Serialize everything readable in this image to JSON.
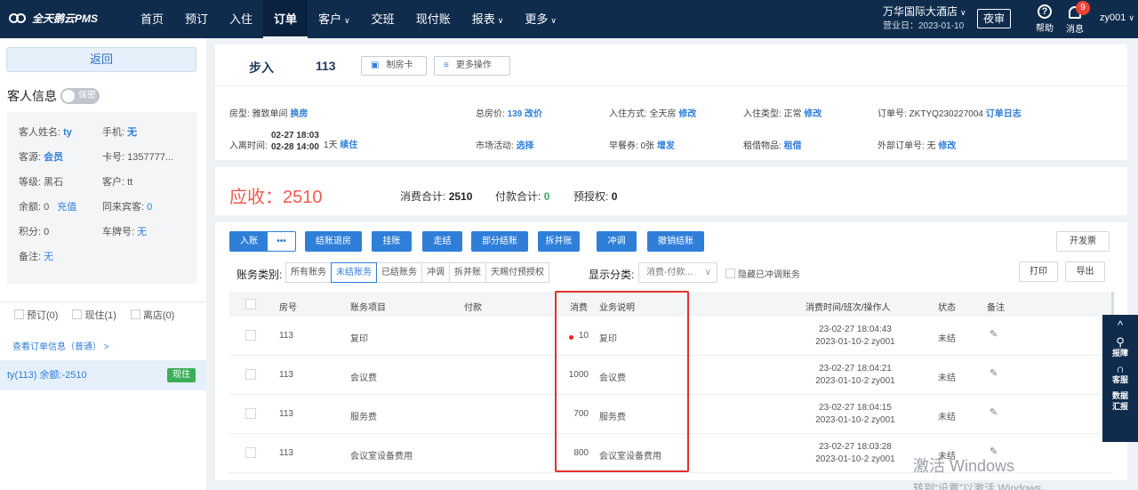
{
  "app": {
    "name": "全天鹅云PMS"
  },
  "nav": [
    "首页",
    "预订",
    "入住",
    "订单",
    "客户",
    "交班",
    "现付账",
    "报表",
    "更多"
  ],
  "hotel": {
    "name": "万华国际大酒店",
    "business_date": "营业日：2023-01-10",
    "night_audit": "夜审"
  },
  "header": {
    "help": "帮助",
    "messages": "消息",
    "message_count": "9",
    "user": "zy001"
  },
  "left": {
    "back": "返回",
    "guest_info_title": "客人信息",
    "secret_label": "保密",
    "fields": {
      "name_label": "客人姓名:",
      "name_value": "ty",
      "phone_label": "手机:",
      "phone_value": "无",
      "source_label": "客源:",
      "source_value": "会员",
      "card_label": "卡号: 1357777...",
      "level_label": "等级: 黑石",
      "customer_label": "客户: tt",
      "balance_label": "余额: 0",
      "recharge": "充值",
      "companions_label": "同来宾客:",
      "companions_value": "0",
      "points_label": "积分: 0",
      "plate_label": "车牌号:",
      "plate_value": "无",
      "remark_label": "备注:",
      "remark_value": "无"
    },
    "filters": {
      "reserved": "预订(0)",
      "inhouse": "现住(1)",
      "checkedout": "离店(0)"
    },
    "view_order": "查看订单信息（普通） >",
    "room_item": "ty(113)  余额:-2510",
    "room_status": "现住"
  },
  "order": {
    "type": "步入",
    "room": "113",
    "make_card": "制房卡",
    "more_ops": "更多操作",
    "room_type_label": "房型: 雅致单间",
    "change_room": "换房",
    "total_price_label": "总房价:",
    "total_price_value": "139",
    "change_price": "改价",
    "checkin_mode_label": "入住方式: 全天房",
    "edit1": "修改",
    "checkin_type_label": "入住类型: 正常",
    "edit2": "修改",
    "order_no_label": "订单号: ZKTYQ230227004",
    "order_log": "订单日志",
    "time_label": "入离时间:",
    "time_in": "02-27 18:03",
    "time_out": "02-28 14:00",
    "nights": "1天",
    "extend": "续住",
    "promo_label": "市场活动:",
    "promo_select": "选择",
    "breakfast_label": "早餐券: 0张",
    "breakfast_add": "增发",
    "rental_label": "租借物品:",
    "rental_link": "租借",
    "ext_order_label": "外部订单号: 无",
    "edit3": "修改"
  },
  "summary": {
    "receivable": "应收：2510",
    "consume_label": "消费合计:",
    "consume_value": "2510",
    "pay_label": "付款合计:",
    "pay_value": "0",
    "preauth_label": "预授权:",
    "preauth_value": "0"
  },
  "actions": {
    "post": "入账",
    "dots": "•••",
    "checkout": "结账退房",
    "hang": "挂账",
    "walk": "走结",
    "partial": "部分结账",
    "split": "拆并账",
    "offset": "冲调",
    "cancel": "撤销结账",
    "invoice": "开发票",
    "print": "打印",
    "export": "导出"
  },
  "filters": {
    "acct_label": "账务类别:",
    "acct_tabs": [
      "所有账务",
      "未结账务",
      "已结账务",
      "冲调",
      "拆并账",
      "天赐付预授权"
    ],
    "acct_selected": 1,
    "display_label": "显示分类:",
    "display_value": "消费-付款...",
    "hide_offset": "隐藏已冲调账务"
  },
  "table": {
    "headers": [
      "房号",
      "账务项目",
      "付款",
      "消费",
      "业务说明",
      "消费时间/班次/操作人",
      "状态",
      "备注"
    ],
    "rows": [
      {
        "room": "113",
        "item": "复印",
        "pay": "",
        "amount": "10",
        "desc": "复印",
        "time": "23-02-27 18:04:43",
        "shift": "2023-01-10-2 zy001",
        "status": "未结"
      },
      {
        "room": "113",
        "item": "会议费",
        "pay": "",
        "amount": "1000",
        "desc": "会议费",
        "time": "23-02-27 18:04:21",
        "shift": "2023-01-10-2 zy001",
        "status": "未结"
      },
      {
        "room": "113",
        "item": "服务费",
        "pay": "",
        "amount": "700",
        "desc": "服务费",
        "time": "23-02-27 18:04:15",
        "shift": "2023-01-10-2 zy001",
        "status": "未结"
      },
      {
        "room": "113",
        "item": "会议室设备费用",
        "pay": "",
        "amount": "800",
        "desc": "会议室设备费用",
        "time": "23-02-27 18:03:28",
        "shift": "2023-01-10-2 zy001",
        "status": "未结"
      }
    ]
  },
  "float": {
    "report": "报障",
    "service": "客服",
    "data": "数据汇报"
  },
  "watermark": {
    "line1": "激活 Windows",
    "line2": "转到“设置”以激活 Windows。"
  },
  "colors": {
    "nav_bg": "#0f2c4d",
    "primary": "#2f7fd9",
    "danger": "#f05a4f",
    "success": "#3bae5a",
    "highlight_box": "#e3302f"
  }
}
